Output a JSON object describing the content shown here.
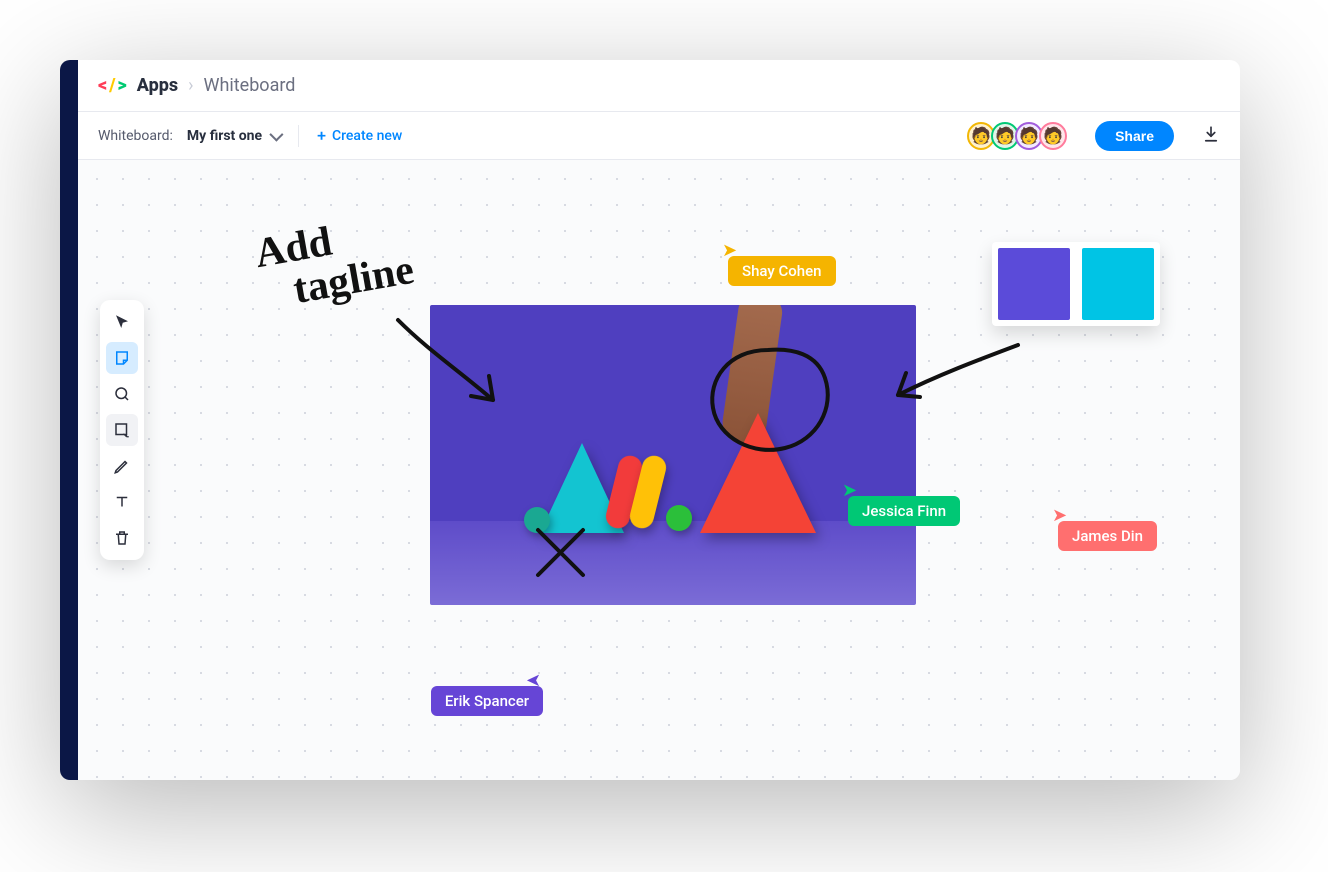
{
  "breadcrumb": {
    "apps_label": "Apps",
    "page_label": "Whiteboard"
  },
  "subbar": {
    "label": "Whiteboard:",
    "selected_board": "My first one",
    "create_label": "Create new",
    "share_label": "Share"
  },
  "avatars": {
    "count": 4
  },
  "tools": {
    "select": "select-tool",
    "sticky": "sticky-note-tool",
    "lasso": "lasso-tool",
    "frame": "frame-tool",
    "pen": "pen-tool",
    "text": "text-tool",
    "trash": "delete-tool"
  },
  "annotation_text": "Add\n   tagline",
  "cursors": {
    "shay": {
      "name": "Shay Cohen",
      "color": "#f5b400"
    },
    "jessica": {
      "name": "Jessica Finn",
      "color": "#00c875"
    },
    "james": {
      "name": "James Din",
      "color": "#ff6f6f"
    },
    "erik": {
      "name": "Erik Spancer",
      "color": "#6645d6"
    }
  },
  "swatches": {
    "a": "#5b4bd9",
    "b": "#00c4e5"
  }
}
